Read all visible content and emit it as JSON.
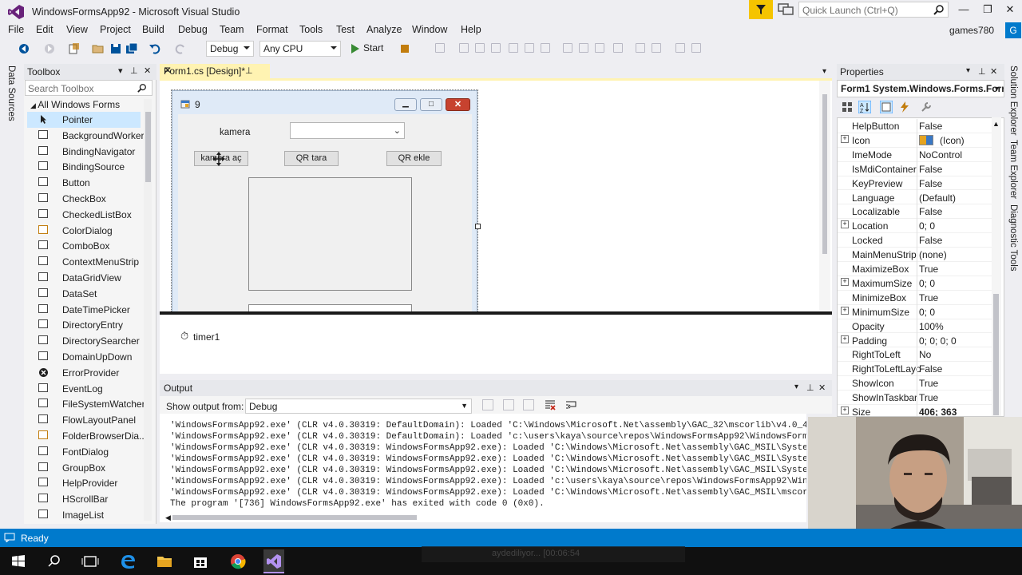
{
  "window": {
    "title": "WindowsFormsApp92 - Microsoft Visual Studio",
    "quick_launch_placeholder": "Quick Launch (Ctrl+Q)",
    "minimize": "—",
    "restore": "❐",
    "close": "✕"
  },
  "menu": [
    "File",
    "Edit",
    "View",
    "Project",
    "Build",
    "Debug",
    "Team",
    "Format",
    "Tools",
    "Test",
    "Analyze",
    "Window",
    "Help"
  ],
  "user": {
    "name": "games780",
    "initials": "G"
  },
  "toolbar": {
    "config": "Debug",
    "platform": "Any CPU",
    "start_label": "Start"
  },
  "left_tab": "Data Sources",
  "toolbox": {
    "title": "Toolbox",
    "search_placeholder": "Search Toolbox",
    "group": "All Windows Forms",
    "items": [
      "Pointer",
      "BackgroundWorker",
      "BindingNavigator",
      "BindingSource",
      "Button",
      "CheckBox",
      "CheckedListBox",
      "ColorDialog",
      "ComboBox",
      "ContextMenuStrip",
      "DataGridView",
      "DataSet",
      "DateTimePicker",
      "DirectoryEntry",
      "DirectorySearcher",
      "DomainUpDown",
      "ErrorProvider",
      "EventLog",
      "FileSystemWatcher",
      "FlowLayoutPanel",
      "FolderBrowserDia...",
      "FontDialog",
      "GroupBox",
      "HelpProvider",
      "HScrollBar",
      "ImageList"
    ]
  },
  "designer": {
    "tab_label": "Form1.cs [Design]*",
    "form": {
      "title": "9",
      "label_kamera": "kamera",
      "btn_open": "kamera aç",
      "btn_scan": "QR tara",
      "btn_add": "QR ekle"
    },
    "tray_component": "timer1"
  },
  "output": {
    "title": "Output",
    "show_from_label": "Show output from:",
    "show_from_value": "Debug",
    "lines": [
      "'WindowsFormsApp92.exe' (CLR v4.0.30319: DefaultDomain): Loaded 'C:\\Windows\\Microsoft.Net\\assembly\\GAC_32\\mscorlib\\v4.0_4",
      "'WindowsFormsApp92.exe' (CLR v4.0.30319: DefaultDomain): Loaded 'c:\\users\\kaya\\source\\repos\\WindowsFormsApp92\\WindowsForm",
      "'WindowsFormsApp92.exe' (CLR v4.0.30319: WindowsFormsApp92.exe): Loaded 'C:\\Windows\\Microsoft.Net\\assembly\\GAC_MSIL\\Syste",
      "'WindowsFormsApp92.exe' (CLR v4.0.30319: WindowsFormsApp92.exe): Loaded 'C:\\Windows\\Microsoft.Net\\assembly\\GAC_MSIL\\Syste",
      "'WindowsFormsApp92.exe' (CLR v4.0.30319: WindowsFormsApp92.exe): Loaded 'C:\\Windows\\Microsoft.Net\\assembly\\GAC_MSIL\\Syste",
      "'WindowsFormsApp92.exe' (CLR v4.0.30319: WindowsFormsApp92.exe): Loaded 'c:\\users\\kaya\\source\\repos\\WindowsFormsApp92\\Win",
      "'WindowsFormsApp92.exe' (CLR v4.0.30319: WindowsFormsApp92.exe): Loaded 'C:\\Windows\\Microsoft.Net\\assembly\\GAC_MSIL\\mscor",
      "The program '[736] WindowsFormsApp92.exe' has exited with code 0 (0x0)."
    ]
  },
  "properties": {
    "title": "Properties",
    "object": "Form1  System.Windows.Forms.Form",
    "rows": [
      {
        "name": "HelpButton",
        "value": "False",
        "expand": ""
      },
      {
        "name": "Icon",
        "value": "(Icon)",
        "expand": "+"
      },
      {
        "name": "ImeMode",
        "value": "NoControl",
        "expand": ""
      },
      {
        "name": "IsMdiContainer",
        "value": "False",
        "expand": ""
      },
      {
        "name": "KeyPreview",
        "value": "False",
        "expand": ""
      },
      {
        "name": "Language",
        "value": "(Default)",
        "expand": ""
      },
      {
        "name": "Localizable",
        "value": "False",
        "expand": ""
      },
      {
        "name": "Location",
        "value": "0; 0",
        "expand": "+"
      },
      {
        "name": "Locked",
        "value": "False",
        "expand": ""
      },
      {
        "name": "MainMenuStrip",
        "value": "(none)",
        "expand": ""
      },
      {
        "name": "MaximizeBox",
        "value": "True",
        "expand": ""
      },
      {
        "name": "MaximumSize",
        "value": "0; 0",
        "expand": "+"
      },
      {
        "name": "MinimizeBox",
        "value": "True",
        "expand": ""
      },
      {
        "name": "MinimumSize",
        "value": "0; 0",
        "expand": "+"
      },
      {
        "name": "Opacity",
        "value": "100%",
        "expand": ""
      },
      {
        "name": "Padding",
        "value": "0; 0; 0; 0",
        "expand": "+"
      },
      {
        "name": "RightToLeft",
        "value": "No",
        "expand": ""
      },
      {
        "name": "RightToLeftLayo",
        "value": "False",
        "expand": ""
      },
      {
        "name": "ShowIcon",
        "value": "True",
        "expand": ""
      },
      {
        "name": "ShowInTaskbar",
        "value": "True",
        "expand": ""
      },
      {
        "name": "Size",
        "value": "406; 363",
        "expand": "+"
      }
    ]
  },
  "right_tabs": [
    "Solution Explorer",
    "Team Explorer",
    "Diagnostic Tools"
  ],
  "status": {
    "text": "Ready"
  },
  "recording_text": "aydediliyor... [00:06:54",
  "colors": {
    "accent": "#007acc",
    "doc_tab": "#fff3b2",
    "notification": "#f5c400"
  }
}
